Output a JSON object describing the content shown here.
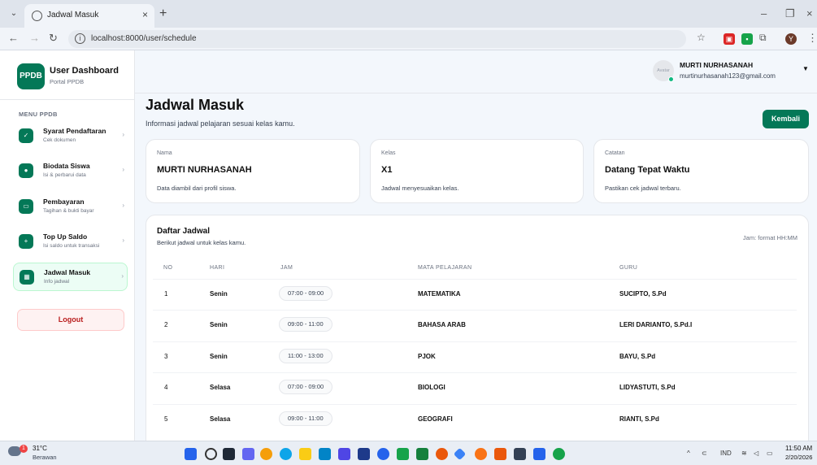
{
  "browser": {
    "tab_title": "Jadwal Masuk",
    "url": "localhost:8000/user/schedule",
    "profile_initial": "Y"
  },
  "sidebar": {
    "brand_logo": "PPDB",
    "brand_title": "User Dashboard",
    "brand_sub": "Portal PPDB",
    "menu_title": "MENU PPDB",
    "items": [
      {
        "label": "Syarat Pendaftaran",
        "sub": "Cek dokumen",
        "icon": "check-icon"
      },
      {
        "label": "Biodata Siswa",
        "sub": "Isi & perbarui data",
        "icon": "user-icon"
      },
      {
        "label": "Pembayaran",
        "sub": "Tagihan & bukti bayar",
        "icon": "card-icon"
      },
      {
        "label": "Top Up Saldo",
        "sub": "Isi saldo untuk transaksi",
        "icon": "plus-icon"
      },
      {
        "label": "Jadwal Masuk",
        "sub": "Info jadwal",
        "icon": "calendar-icon"
      }
    ],
    "logout_label": "Logout"
  },
  "header": {
    "avatar_alt": "Avatar",
    "user_name": "MURTI NURHASANAH",
    "user_email": "murtinurhasanah123@gmail.com"
  },
  "page": {
    "title": "Jadwal Masuk",
    "subtitle": "Informasi jadwal pelajaran sesuai kelas kamu.",
    "back_label": "Kembali"
  },
  "info_cards": [
    {
      "label": "Nama",
      "value": "MURTI NURHASANAH",
      "note": "Data diambil dari profil siswa."
    },
    {
      "label": "Kelas",
      "value": "X1",
      "note": "Jadwal menyesuaikan kelas."
    },
    {
      "label": "Catatan",
      "value": "Datang Tepat Waktu",
      "note": "Pastikan cek jadwal terbaru."
    }
  ],
  "schedule": {
    "title": "Daftar Jadwal",
    "subtitle": "Berikut jadwal untuk kelas kamu.",
    "note": "Jam: format HH:MM",
    "columns": [
      "NO",
      "HARI",
      "JAM",
      "MATA PELAJARAN",
      "GURU"
    ],
    "rows": [
      {
        "no": "1",
        "hari": "Senin",
        "jam": "07:00 - 09:00",
        "mapel": "MATEMATIKA",
        "guru": "SUCIPTO, S.Pd"
      },
      {
        "no": "2",
        "hari": "Senin",
        "jam": "09:00 - 11:00",
        "mapel": "BAHASA ARAB",
        "guru": "LERI DARIANTO, S.Pd.I"
      },
      {
        "no": "3",
        "hari": "Senin",
        "jam": "11:00 - 13:00",
        "mapel": "PJOK",
        "guru": "BAYU, S.Pd"
      },
      {
        "no": "4",
        "hari": "Selasa",
        "jam": "07:00 - 09:00",
        "mapel": "BIOLOGI",
        "guru": "LIDYASTUTI, S.Pd"
      },
      {
        "no": "5",
        "hari": "Selasa",
        "jam": "09:00 - 11:00",
        "mapel": "GEOGRAFI",
        "guru": "RIANTI, S.Pd"
      }
    ]
  },
  "taskbar": {
    "weather_badge": "1",
    "temperature": "31°C",
    "weather": "Berawan",
    "language": "IND",
    "time": "11:50 AM",
    "date": "2/20/2026"
  },
  "colors": {
    "accent": "#047857",
    "logout_bg": "#fef2f2",
    "logout_text": "#b91c1c"
  }
}
